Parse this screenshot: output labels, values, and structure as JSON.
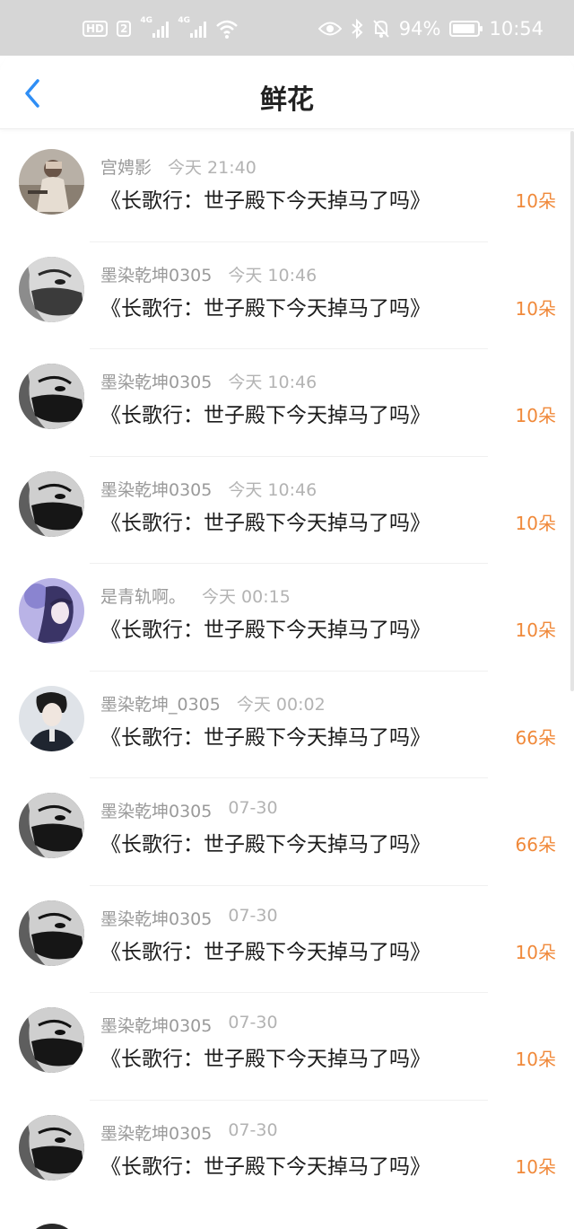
{
  "status_bar": {
    "hd": "HD",
    "sim": "2",
    "signal1": "4G",
    "signal2": "4G",
    "battery": "94%",
    "time": "10:54"
  },
  "header": {
    "title": "鲜花"
  },
  "items": [
    {
      "name": "宫娉影",
      "time": "今天 21:40",
      "book": "《长歌行：世子殿下今天掉马了吗》",
      "amount": "10朵",
      "avatar": "photo-icon"
    },
    {
      "name": "墨染乾坤0305",
      "time": "今天 10:46",
      "book": "《长歌行：世子殿下今天掉马了吗》",
      "amount": "10朵",
      "avatar": "masked-portrait-icon"
    },
    {
      "name": "墨染乾坤0305",
      "time": "今天 10:46",
      "book": "《长歌行：世子殿下今天掉马了吗》",
      "amount": "10朵",
      "avatar": "masked-portrait-icon"
    },
    {
      "name": "墨染乾坤0305",
      "time": "今天 10:46",
      "book": "《长歌行：世子殿下今天掉马了吗》",
      "amount": "10朵",
      "avatar": "masked-portrait-icon"
    },
    {
      "name": "是青轨啊。",
      "time": "今天 00:15",
      "book": "《长歌行：世子殿下今天掉马了吗》",
      "amount": "10朵",
      "avatar": "illustrated-portrait-icon"
    },
    {
      "name": "墨染乾坤_0305",
      "time": "今天 00:02",
      "book": "《长歌行：世子殿下今天掉马了吗》",
      "amount": "66朵",
      "avatar": "portrait-icon"
    },
    {
      "name": "墨染乾坤0305",
      "time": "07-30",
      "book": "《长歌行：世子殿下今天掉马了吗》",
      "amount": "66朵",
      "avatar": "masked-portrait-icon"
    },
    {
      "name": "墨染乾坤0305",
      "time": "07-30",
      "book": "《长歌行：世子殿下今天掉马了吗》",
      "amount": "10朵",
      "avatar": "masked-portrait-icon"
    },
    {
      "name": "墨染乾坤0305",
      "time": "07-30",
      "book": "《长歌行：世子殿下今天掉马了吗》",
      "amount": "10朵",
      "avatar": "masked-portrait-icon"
    },
    {
      "name": "墨染乾坤0305",
      "time": "07-30",
      "book": "《长歌行：世子殿下今天掉马了吗》",
      "amount": "10朵",
      "avatar": "masked-portrait-icon"
    }
  ],
  "colors": {
    "accent": "#2f8ef5",
    "amount": "#f0893a",
    "statusbar": "#d6d6d6"
  }
}
